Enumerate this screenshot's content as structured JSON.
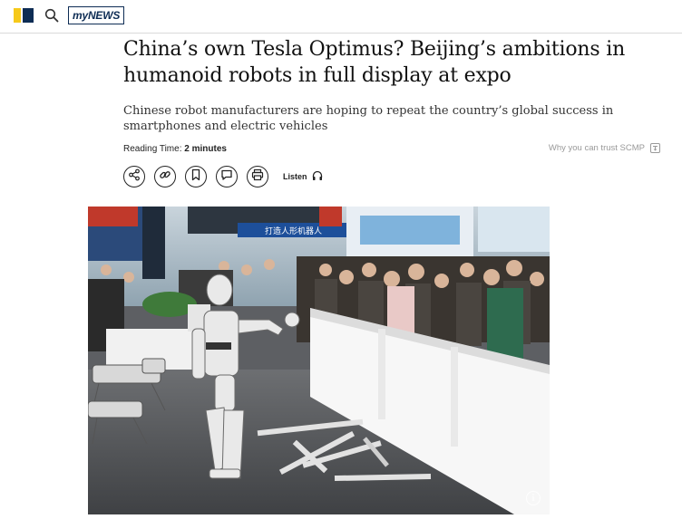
{
  "header": {
    "brand_logo_icon": "scmp-logo",
    "search_icon": "search-icon",
    "mynews_label": "myNEWS",
    "colors": {
      "logo_yellow": "#f6c91a",
      "logo_navy": "#0d2c54"
    }
  },
  "article": {
    "headline": "China’s own Tesla Optimus? Beijing’s ambitions in humanoid robots in full display at expo",
    "subheadline": "Chinese robot manufacturers are hoping to repeat the country’s global success in smartphones and electric vehicles",
    "reading_time_label": "Reading Time:",
    "reading_time_value": "2 minutes",
    "trust_link": "Why you can trust SCMP"
  },
  "toolbar": {
    "share_icon": "share-icon",
    "link_icon": "link-icon",
    "bookmark_icon": "bookmark-icon",
    "comment_icon": "comment-icon",
    "print_icon": "print-icon",
    "listen_label": "Listen",
    "headphones_icon": "headphones-icon"
  },
  "hero_image": {
    "banner_text": "打造人形机器人",
    "info_icon": "info-icon",
    "info_glyph": "i"
  }
}
